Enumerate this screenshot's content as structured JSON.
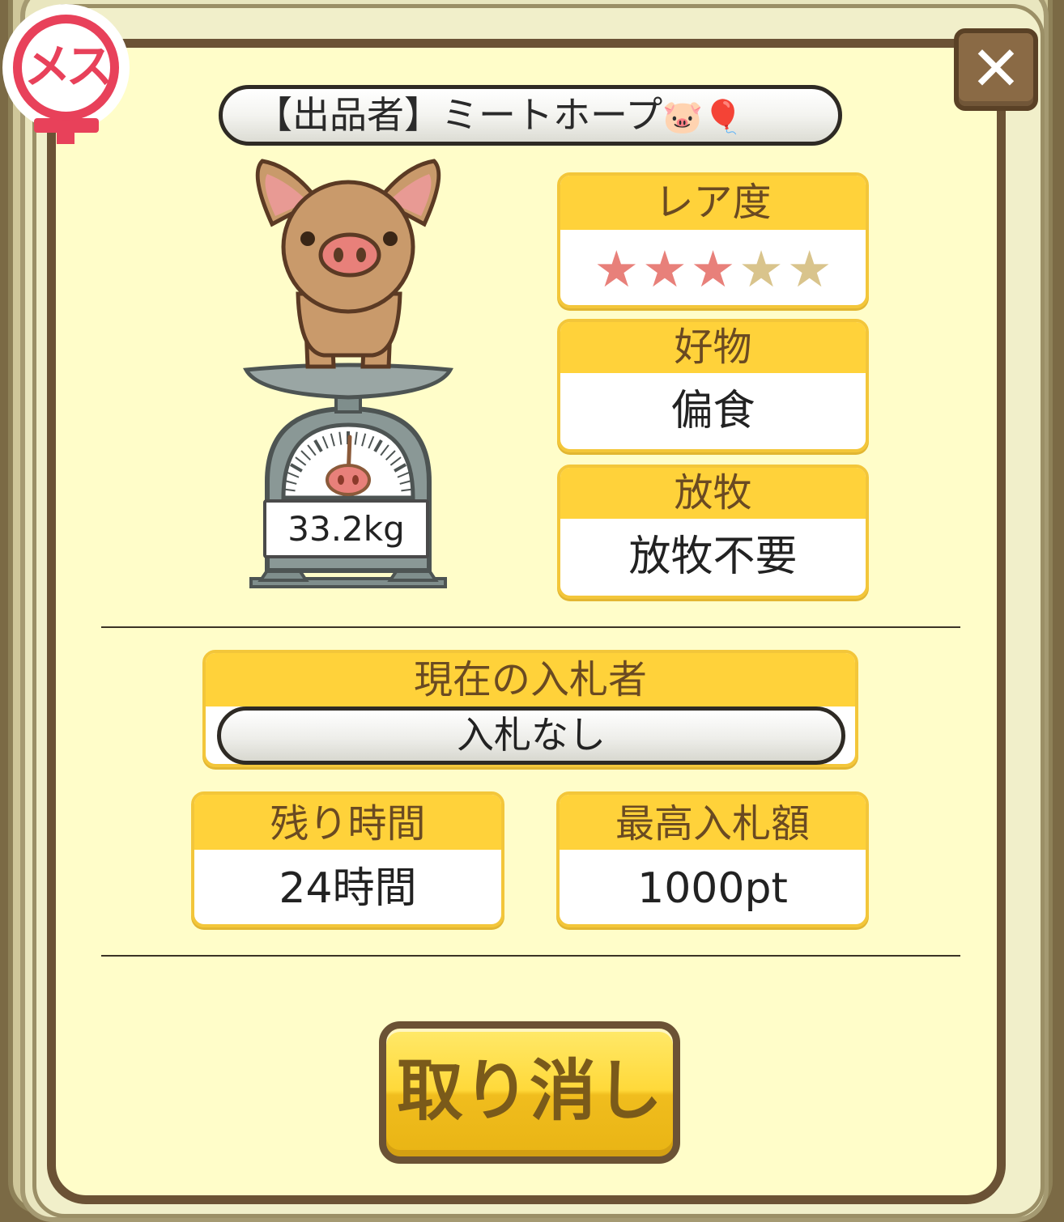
{
  "badge": {
    "label": "メス"
  },
  "close_button": {
    "label": "✕"
  },
  "seller": {
    "label": "【出品者】ミートホープ",
    "emoji_pig": "🐷",
    "emoji_balloon": "🎈"
  },
  "pig": {
    "weight": "33.2kg"
  },
  "rarity": {
    "label": "レア度",
    "value": 3,
    "max": 5,
    "filled_color": "#E8807A",
    "empty_color": "#D9C48C"
  },
  "favorite_food": {
    "label": "好物",
    "value": "偏食"
  },
  "grazing": {
    "label": "放牧",
    "value": "放牧不要"
  },
  "current_bidder": {
    "label": "現在の入札者",
    "value": "入札なし"
  },
  "time_left": {
    "label": "残り時間",
    "value": "24時間"
  },
  "highest_bid": {
    "label": "最高入札額",
    "value": "1000pt"
  },
  "cancel_button": {
    "label": "取り消し"
  },
  "colors": {
    "panel_bg": "#FFFDC9",
    "panel_border": "#6B5235",
    "card_header": "#FFD23A",
    "card_border": "#F3C63A",
    "badge": "#E8415A",
    "button": "#FFD93A"
  }
}
